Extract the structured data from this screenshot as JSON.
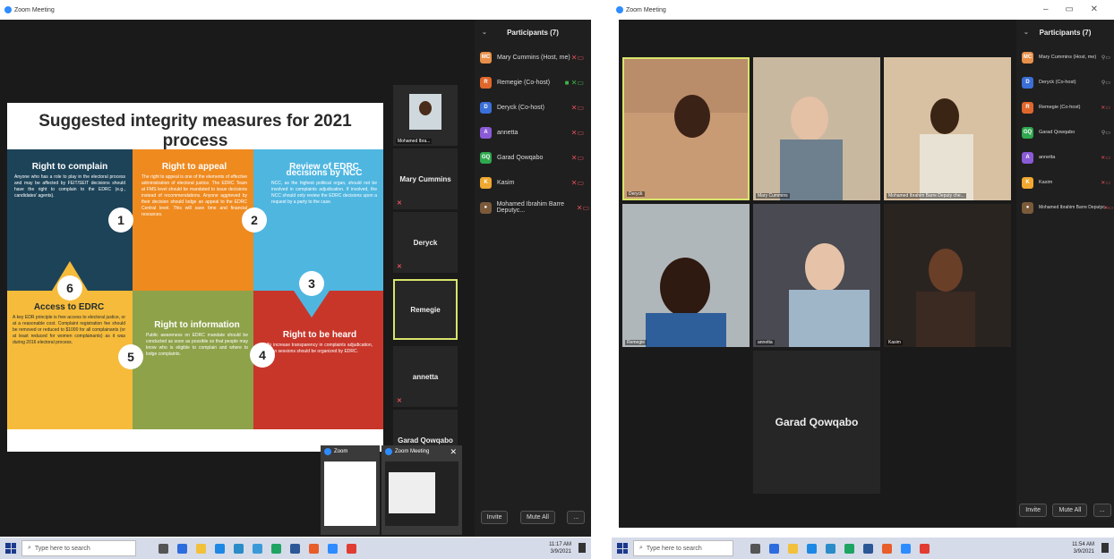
{
  "left": {
    "title": "Zoom Meeting",
    "slide": {
      "title": "Suggested integrity measures for 2021 process",
      "q1": {
        "title": "Right to complain",
        "num": "1",
        "body": "Anyone who has a role to play in the electoral process and may be affected by FEIT/SEIT decisions should have the right to complain to the EDRC (e.g., candidates' agents)."
      },
      "q2": {
        "title": "Right to appeal",
        "num": "2",
        "body": "The right to appeal is one of the elements of effective administration of electoral justice. The EDRC Team at FMS level should be mandated to issue decisions instead of recommendations. Anyone aggrieved by their decision should lodge an appeal to the EDRC Central level. This will save time and financial resources."
      },
      "q3": {
        "title": "Review of EDRC decisions by NCC",
        "num": "3",
        "body": "NCC, as the highest political organ, should not be involved in complaints adjudication. If involved, the NCC should only review the EDRC decisions upon a request by a party to the case."
      },
      "q4": {
        "title": "Right to be heard",
        "num": "4",
        "body": "To increase transparency in complaints adjudication, open sessions should be organized by EDRC."
      },
      "q5": {
        "title": "Right to information",
        "num": "5",
        "body": "Public awareness on EDRC mandate should be conducted as soon as possible so that people may know who is eligible to complain and where to lodge complaints."
      },
      "q6": {
        "title": "Access to EDRC",
        "num": "6",
        "body": "A key EDR principle is free access to electoral justice, or at a reasonable cost. Complaint registration fee should be removed or reduced to $1000 for all complainants (or at least reduced for women complainants) as it was during 2016 electoral process."
      }
    },
    "gallery": [
      {
        "name": "Mohamed Ibra..."
      },
      {
        "name": "Mary Cummins"
      },
      {
        "name": "Deryck"
      },
      {
        "name": "Remegie"
      },
      {
        "name": "annetta"
      },
      {
        "name": "Garad Qowqabo"
      }
    ],
    "participants": {
      "header": "Participants (7)",
      "list": [
        {
          "initials": "MC",
          "name": "Mary Cummins (Host, me)",
          "color": "#e8904a"
        },
        {
          "initials": "R",
          "name": "Remegie (Co-host)",
          "color": "#e0672c"
        },
        {
          "initials": "D",
          "name": "Deryck (Co-host)",
          "color": "#3b6fd8"
        },
        {
          "initials": "A",
          "name": "annetta",
          "color": "#8a5bd6"
        },
        {
          "initials": "GQ",
          "name": "Garad Qowqabo",
          "color": "#2fa84f"
        },
        {
          "initials": "K",
          "name": "Kasim",
          "color": "#f0a830"
        },
        {
          "initials": "",
          "name": "Mohamed Ibrahim Barre Deputyc...",
          "color": "#7a5a3a"
        }
      ],
      "invite": "Invite",
      "mute_all": "Mute All",
      "more": "..."
    },
    "popups": [
      {
        "title": "Zoom"
      },
      {
        "title": "Zoom Meeting"
      }
    ],
    "taskbar": {
      "search": "Type here to search",
      "time": "11:17 AM",
      "date": "3/9/2021"
    }
  },
  "right": {
    "title": "Zoom Meeting",
    "tiles": [
      {
        "name": "Deryck"
      },
      {
        "name": "Mary Cummins"
      },
      {
        "name": "Mohamed Ibrahim Barre Deputy che..."
      },
      {
        "name": "Remegie"
      },
      {
        "name": "annetta"
      },
      {
        "name": "Kasim"
      }
    ],
    "big_name": "Garad Qowqabo",
    "participants": {
      "header": "Participants (7)",
      "list": [
        {
          "initials": "MC",
          "name": "Mary Cummins (Host, me)",
          "color": "#e8904a"
        },
        {
          "initials": "D",
          "name": "Deryck (Co-host)",
          "color": "#3b6fd8"
        },
        {
          "initials": "R",
          "name": "Remegie (Co-host)",
          "color": "#e0672c"
        },
        {
          "initials": "GQ",
          "name": "Garad Qowqabo",
          "color": "#2fa84f"
        },
        {
          "initials": "A",
          "name": "annetta",
          "color": "#8a5bd6"
        },
        {
          "initials": "K",
          "name": "Kasim",
          "color": "#f0a830"
        },
        {
          "initials": "",
          "name": "Mohamed Ibrahim Barre Deputyc...",
          "color": "#7a5a3a"
        }
      ],
      "invite": "Invite",
      "mute_all": "Mute All",
      "more": "..."
    },
    "taskbar": {
      "search": "Type here to search",
      "time": "11:54 AM",
      "date": "3/9/2021"
    }
  }
}
